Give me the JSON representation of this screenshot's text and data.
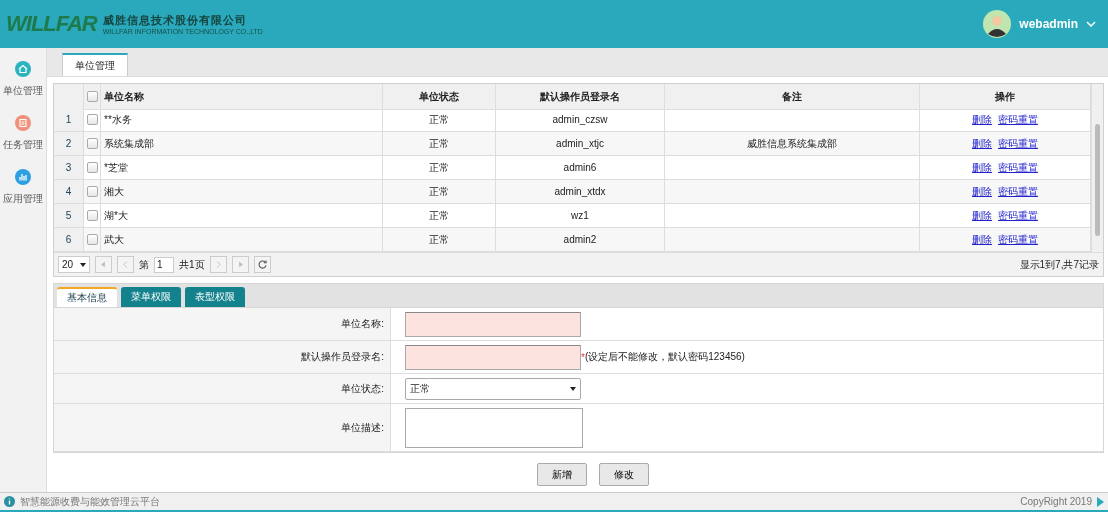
{
  "header": {
    "logo_text": "WILLFAR",
    "company_name": "威胜信息技术股份有限公司",
    "company_name_en": "WILLFAR INFORMATION TECHNOLOGY CO.,LTD",
    "user": "webadmin"
  },
  "sidebar": {
    "items": [
      {
        "kind": "home",
        "label": "单位管理"
      },
      {
        "kind": "task",
        "label": "任务管理"
      },
      {
        "kind": "chart",
        "label": "应用管理"
      }
    ]
  },
  "page_tabs": [
    {
      "label": "单位管理",
      "selected": true
    }
  ],
  "table": {
    "header_checked": false,
    "columns": [
      "单位名称",
      "单位状态",
      "默认操作员登录名",
      "备注",
      "操作"
    ],
    "rows": [
      {
        "index": "1",
        "checked": false,
        "name": "**水务",
        "status": "正常",
        "login": "admin_czsw",
        "remark": "",
        "actions": [
          "删除",
          "密码重置"
        ]
      },
      {
        "index": "2",
        "checked": false,
        "name": "系统集成部",
        "status": "正常",
        "login": "admin_xtjc",
        "remark": "威胜信息系统集成部",
        "actions": [
          "删除",
          "密码重置"
        ]
      },
      {
        "index": "3",
        "checked": false,
        "name": "*芝堂",
        "status": "正常",
        "login": "admin6",
        "remark": "",
        "actions": [
          "删除",
          "密码重置"
        ]
      },
      {
        "index": "4",
        "checked": false,
        "name": "湘大",
        "status": "正常",
        "login": "admin_xtdx",
        "remark": "",
        "actions": [
          "删除",
          "密码重置"
        ]
      },
      {
        "index": "5",
        "checked": false,
        "name": "湖*大",
        "status": "正常",
        "login": "wz1",
        "remark": "",
        "actions": [
          "删除",
          "密码重置"
        ]
      },
      {
        "index": "6",
        "checked": false,
        "name": "武大",
        "status": "正常",
        "login": "admin2",
        "remark": "",
        "actions": [
          "删除",
          "密码重置"
        ]
      }
    ]
  },
  "pager": {
    "page_size": "20",
    "page_prefix": "第",
    "page": "1",
    "page_suffix": "共1页",
    "summary": "显示1到7,共7记录"
  },
  "form_tabs": [
    {
      "label": "基本信息",
      "selected": true
    },
    {
      "label": "菜单权限",
      "selected": false
    },
    {
      "label": "表型权限",
      "selected": false
    }
  ],
  "form": {
    "fields": [
      {
        "kind": "text",
        "label": "单位名称:",
        "highlighted": true
      },
      {
        "kind": "text",
        "label": "默认操作员登录名:",
        "highlighted": true,
        "required_mark": "*",
        "note": "(设定后不能修改，默认密码123456)"
      },
      {
        "kind": "select",
        "label": "单位状态:",
        "highlighted": false,
        "value": "正常"
      },
      {
        "kind": "textarea",
        "label": "单位描述:",
        "highlighted": false
      }
    ]
  },
  "buttons": [
    "新增",
    "修改"
  ],
  "footer": {
    "text": "智慧能源收费与能效管理云平台",
    "copyright": "CopyRight 2019"
  }
}
